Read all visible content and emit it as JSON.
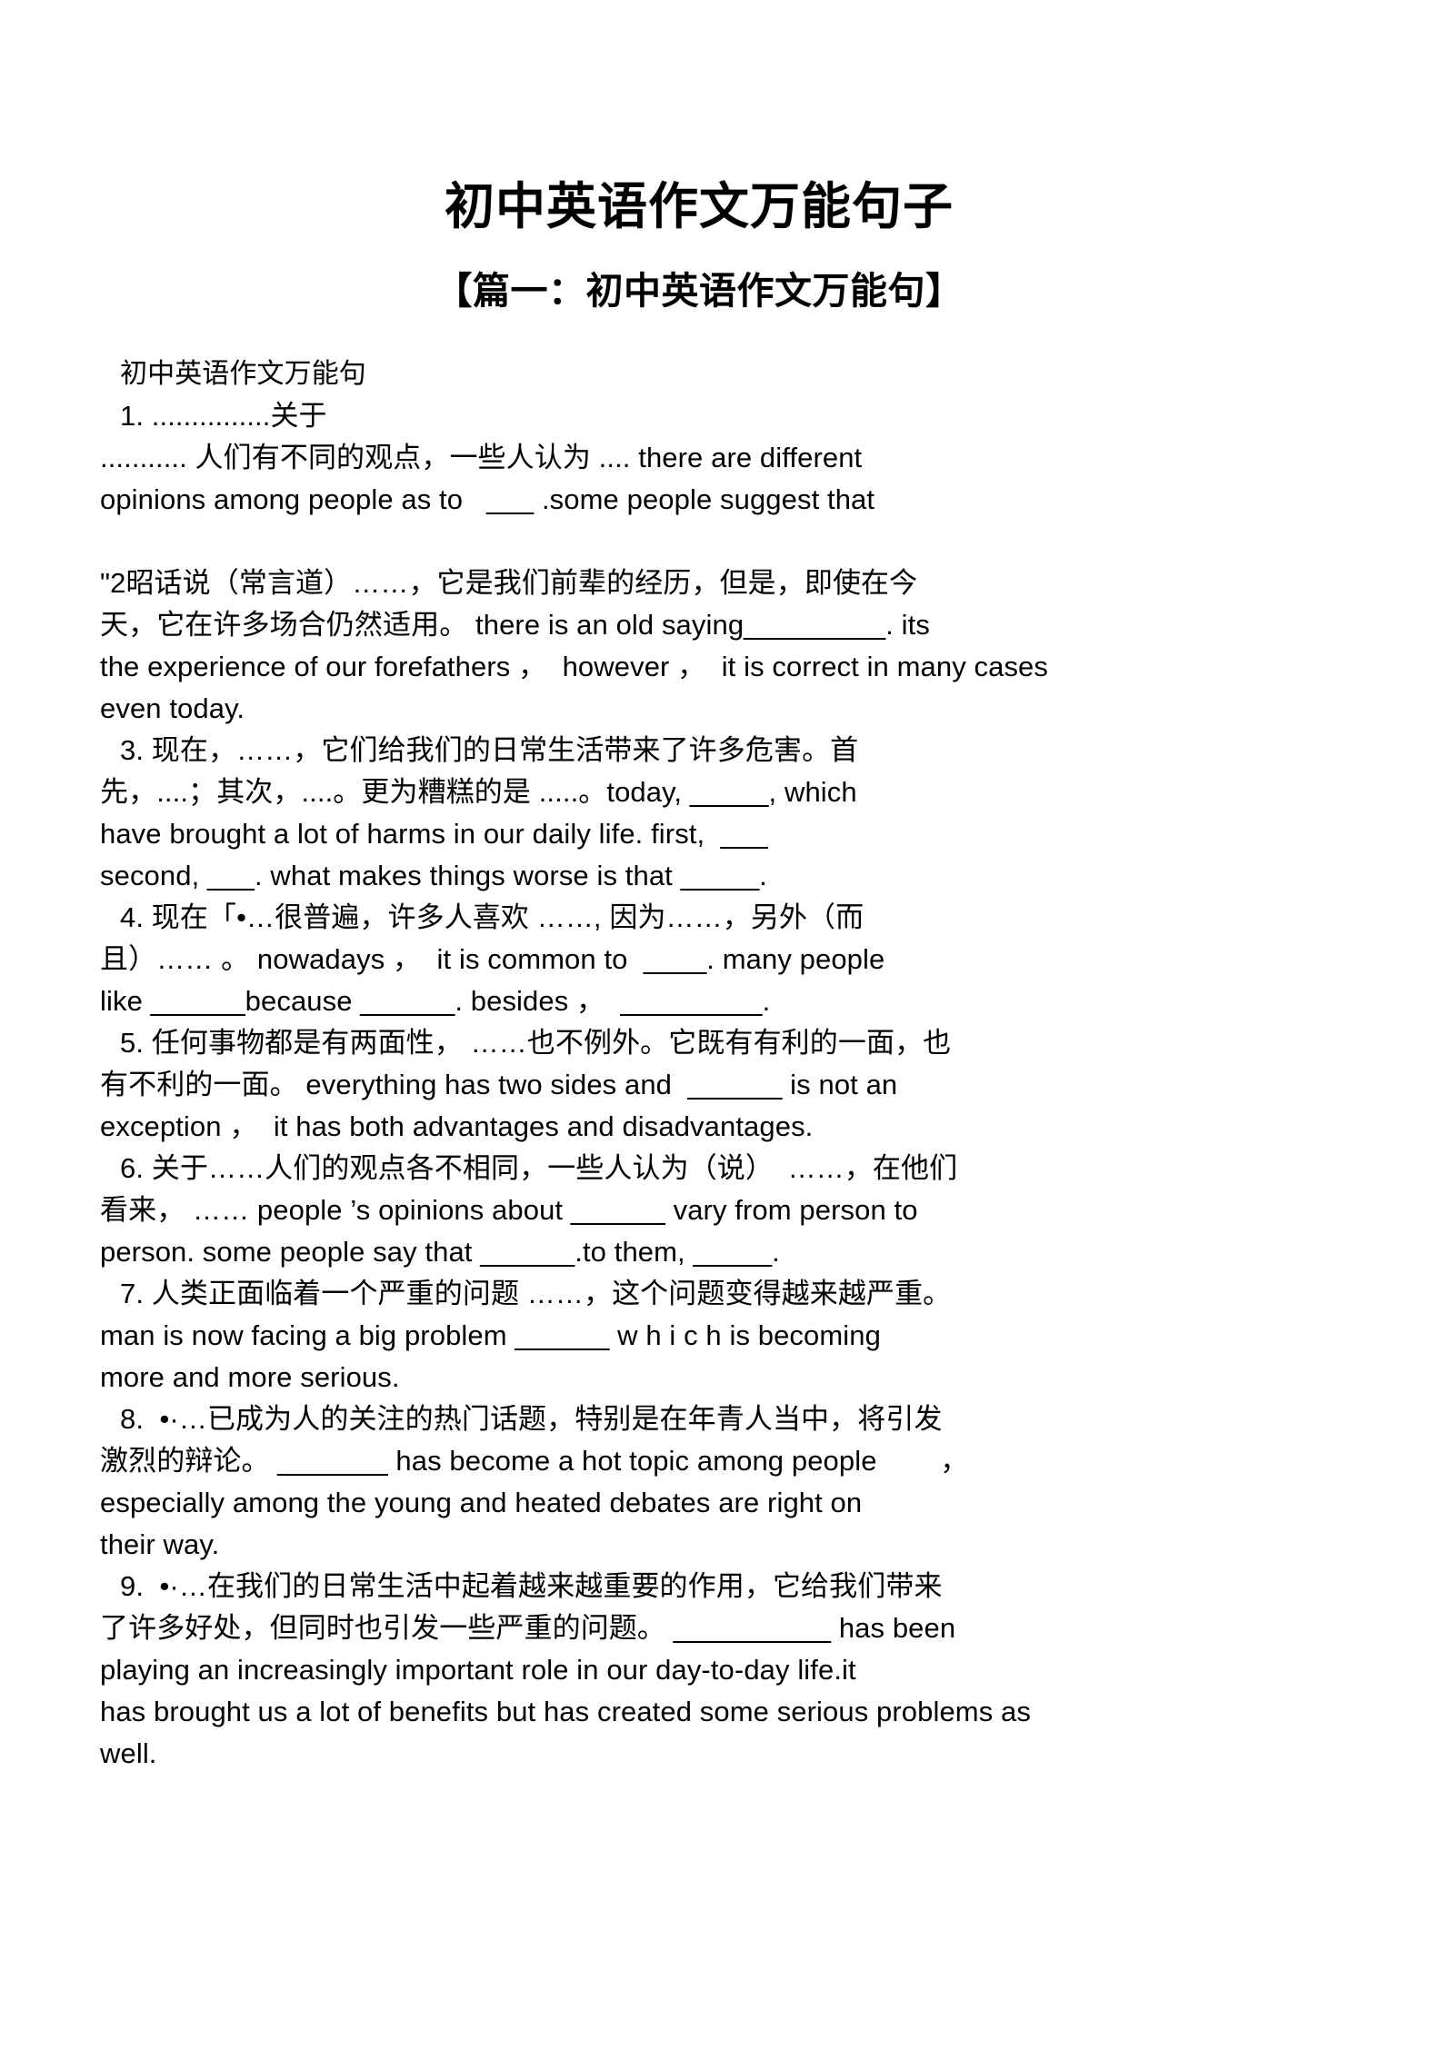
{
  "document": {
    "title": "初中英语作文万能句子",
    "subtitle": "【篇一：初中英语作文万能句】",
    "heading": "初中英语作文万能句",
    "items": [
      {
        "id": "item-1",
        "lines": [
          {
            "kind": "mix",
            "text": "1. ...............关于"
          },
          {
            "kind": "mix",
            "text": "........... 人们有不同的观点，一些人认为 .... there are different"
          },
          {
            "kind": "en",
            "text": "opinions among people as to   ___ .some people suggest that"
          }
        ]
      },
      {
        "id": "item-2",
        "lines": [
          {
            "kind": "mix",
            "text": "\"2昭话说（常言道）……，它是我们前辈的经历，但是，即使在今"
          },
          {
            "kind": "mix",
            "text": "天，它在许多场合仍然适用。 there is an old saying_________. its"
          },
          {
            "kind": "en",
            "text": "the experience of our forefathers ，  however ，  it is correct in many cases"
          },
          {
            "kind": "en",
            "text": "even today."
          }
        ]
      },
      {
        "id": "item-3",
        "lines": [
          {
            "kind": "mix",
            "text": "3. 现在，……，它们给我们的日常生活带来了许多危害。首"
          },
          {
            "kind": "mix",
            "text": "先，....；其次，....。更为糟糕的是 .....。today, _____, which"
          },
          {
            "kind": "en",
            "text": "have brought a lot of harms in our daily life. first,  ___"
          },
          {
            "kind": "en",
            "text": "second, ___. what makes things worse is that _____."
          }
        ]
      },
      {
        "id": "item-4",
        "lines": [
          {
            "kind": "mix",
            "text": "4. 现在「•…很普遍，许多人喜欢 ……, 因为……，另外（而"
          },
          {
            "kind": "mix",
            "text": "且）…… 。 nowadays ，  it is common to  ____. many people"
          },
          {
            "kind": "en",
            "text": "like ______because ______. besides ，  _________."
          }
        ]
      },
      {
        "id": "item-5",
        "lines": [
          {
            "kind": "mix",
            "text": "5. 任何事物都是有两面性， ……也不例外。它既有有利的一面，也"
          },
          {
            "kind": "mix",
            "text": "有不利的一面。 everything has two sides and  ______ is not an"
          },
          {
            "kind": "en",
            "text": "exception ，  it has both advantages and disadvantages."
          }
        ]
      },
      {
        "id": "item-6",
        "lines": [
          {
            "kind": "mix",
            "text": "6. 关于……人们的观点各不相同，一些人认为（说）　……，在他们"
          },
          {
            "kind": "mix",
            "text": "看来， …… people ’s opinions about ______ vary from person to"
          },
          {
            "kind": "en",
            "text": "person. some people say that ______.to them, _____."
          }
        ]
      },
      {
        "id": "item-7",
        "lines": [
          {
            "kind": "mix",
            "text": "7. 人类正面临着一个严重的问题 ……，这个问题变得越来越严重。"
          },
          {
            "kind": "en",
            "text": "man is now facing a big problem ______ w h i c h is becoming"
          },
          {
            "kind": "en",
            "text": "more and more serious."
          }
        ]
      },
      {
        "id": "item-8",
        "lines": [
          {
            "kind": "mix",
            "text": "8.  •·…已成为人的关注的热门话题，特别是在年青人当中，将引发"
          },
          {
            "kind": "mix",
            "text": "激烈的辩论。 _______ has become a hot topic among people        ，"
          },
          {
            "kind": "en",
            "text": "especially among the young and heated debates are right on"
          },
          {
            "kind": "en",
            "text": "their way."
          }
        ]
      },
      {
        "id": "item-9",
        "lines": [
          {
            "kind": "mix",
            "text": "9.  •·…在我们的日常生活中起着越来越重要的作用，它给我们带来"
          },
          {
            "kind": "mix",
            "text": "了许多好处，但同时也引发一些严重的问题。 __________ has been"
          },
          {
            "kind": "en",
            "text": "playing an increasingly important role in our day-to-day life.it"
          },
          {
            "kind": "en",
            "text": "has brought us a lot of benefits but has created some serious problems as"
          },
          {
            "kind": "en",
            "text": "well."
          }
        ]
      }
    ]
  },
  "colors": {
    "page_background": "#ffffff",
    "text": "#000000"
  }
}
